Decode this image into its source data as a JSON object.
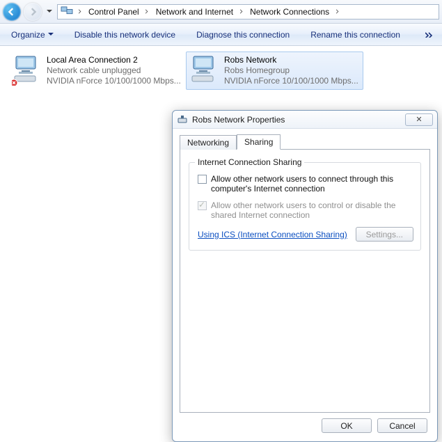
{
  "breadcrumbs": {
    "items": [
      "Control Panel",
      "Network and Internet",
      "Network Connections"
    ]
  },
  "toolbar": {
    "organize": "Organize",
    "disable": "Disable this network device",
    "diagnose": "Diagnose this connection",
    "rename": "Rename this connection"
  },
  "connections": [
    {
      "name": "Local Area Connection 2",
      "status": "Network cable unplugged",
      "adapter": "NVIDIA nForce 10/100/1000 Mbps...",
      "error": true,
      "selected": false
    },
    {
      "name": "Robs Network",
      "status": "Robs Homegroup",
      "adapter": "NVIDIA nForce 10/100/1000 Mbps...",
      "error": false,
      "selected": true
    }
  ],
  "dialog": {
    "title": "Robs Network Properties",
    "tabs": {
      "networking": "Networking",
      "sharing": "Sharing"
    },
    "group_title": "Internet Connection Sharing",
    "allow_connect": "Allow other network users to connect through this computer's Internet connection",
    "allow_control": "Allow other network users to control or disable the shared Internet connection",
    "link": "Using ICS (Internet Connection Sharing)",
    "settings": "Settings...",
    "ok": "OK",
    "cancel": "Cancel"
  }
}
